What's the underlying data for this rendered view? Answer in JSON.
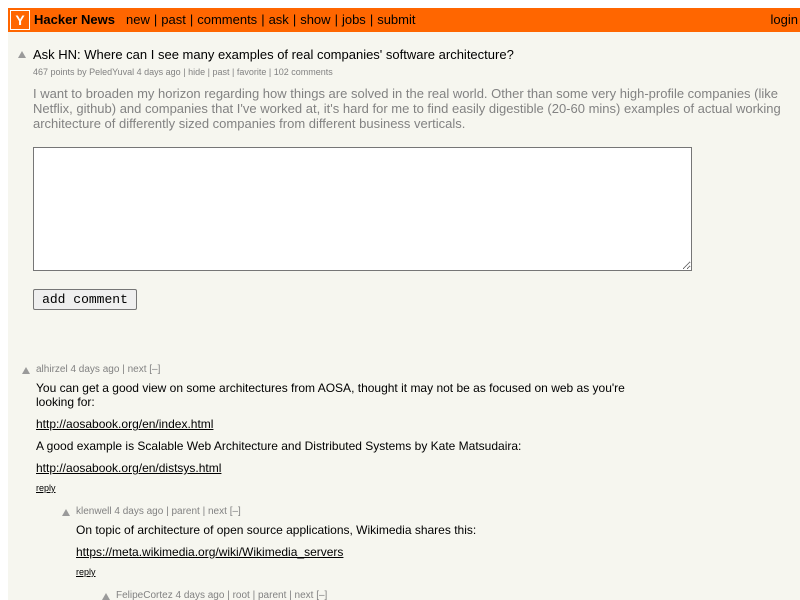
{
  "header": {
    "logo_letter": "Y",
    "site_name": "Hacker News",
    "nav": [
      "new",
      "past",
      "comments",
      "ask",
      "show",
      "jobs",
      "submit"
    ],
    "login": "login"
  },
  "story": {
    "title": "Ask HN: Where can I see many examples of real companies' software architecture?",
    "points": "467 points",
    "by": "by",
    "user": "PeledYuval",
    "age": "4 days ago",
    "hide": "hide",
    "past": "past",
    "favorite": "favorite",
    "comments": "102 comments",
    "text": "I want to broaden my horizon regarding how things are solved in the real world. Other than some very high-profile companies (like Netflix, github) and companies that I've worked at, it's hard for me to find easily digestible (20-60 mins) examples of actual working architecture of differently sized companies from different business verticals."
  },
  "comment_form": {
    "textarea_value": "",
    "submit_label": "add comment"
  },
  "comments": [
    {
      "user": "alhirzel",
      "age": "4 days ago",
      "links": [
        "next"
      ],
      "toggle": "[–]",
      "paragraphs": [
        "You can get a good view on some architectures from AOSA, thought it may not be as focused on web as you're looking for:",
        "http://aosabook.org/en/index.html",
        "A good example is Scalable Web Architecture and Distributed Systems by Kate Matsudaira:",
        "http://aosabook.org/en/distsys.html"
      ],
      "reply": "reply"
    },
    {
      "user": "klenwell",
      "age": "4 days ago",
      "links": [
        "parent",
        "next"
      ],
      "toggle": "[–]",
      "paragraphs": [
        "On topic of architecture of open source applications, Wikimedia shares this:",
        "https://meta.wikimedia.org/wiki/Wikimedia_servers"
      ],
      "reply": "reply"
    },
    {
      "user": "FelipeCortez",
      "age": "4 days ago",
      "links": [
        "root",
        "parent",
        "next"
      ],
      "toggle": "[–]"
    }
  ],
  "colors": {
    "header_bg": "#ff6600",
    "page_bg": "#f6f6ef",
    "meta_text": "#828282"
  }
}
